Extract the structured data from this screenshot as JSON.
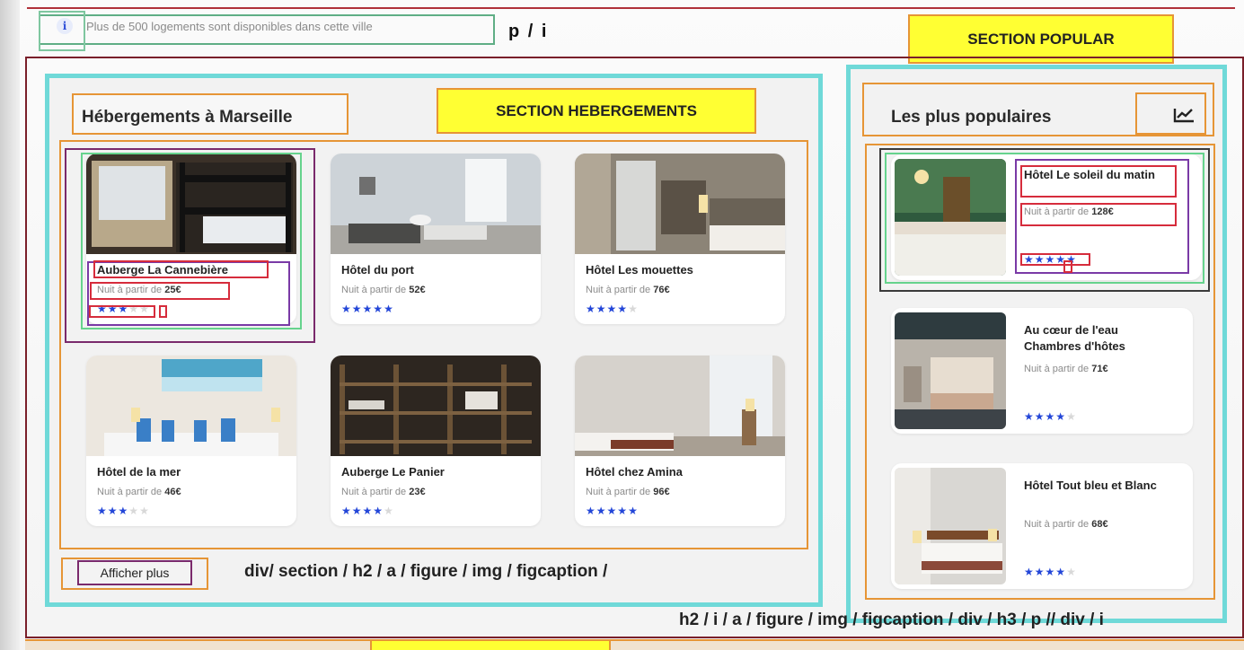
{
  "info": {
    "icon": "info-icon",
    "glyph": "i",
    "text": "Plus de 500 logements sont disponibles dans cette ville",
    "tag": "p / i"
  },
  "labels": {
    "popular": "SECTION POPULAR",
    "hebergements": "SECTION HEBERGEMENTS"
  },
  "hebergements": {
    "title": "Hébergements à Marseille",
    "price_prefix": "Nuit à partir de",
    "cards": [
      {
        "name": "Auberge La Cannebière",
        "price": "25€",
        "rating": 3,
        "max": 5
      },
      {
        "name": "Hôtel du port",
        "price": "52€",
        "rating": 5,
        "max": 5
      },
      {
        "name": "Hôtel Les mouettes",
        "price": "76€",
        "rating": 4,
        "max": 5
      },
      {
        "name": "Hôtel de la mer",
        "price": "46€",
        "rating": 3,
        "max": 5
      },
      {
        "name": "Auberge Le Panier",
        "price": "23€",
        "rating": 4,
        "max": 5
      },
      {
        "name": "Hôtel chez Amina",
        "price": "96€",
        "rating": 5,
        "max": 5
      }
    ],
    "show_more": "Afficher plus",
    "tags": "div/ section / h2 / a / figure / img / figcaption /"
  },
  "popular": {
    "title": "Les plus populaires",
    "chart_icon": "trending-chart-icon",
    "price_prefix": "Nuit à partir de",
    "cards": [
      {
        "name": "Hôtel Le soleil du matin",
        "price": "128€",
        "rating": 5,
        "max": 5
      },
      {
        "name": "Au cœur de l'eau Chambres d'hôtes",
        "price": "71€",
        "rating": 4,
        "max": 5
      },
      {
        "name": "Hôtel Tout bleu et Blanc",
        "price": "68€",
        "rating": 4,
        "max": 5
      }
    ],
    "tags": "h2 / i / a / figure / img / figcaption / div / h3 / p // div / i"
  },
  "colors": {
    "star": "#2346d8",
    "star_empty": "#d8d8d8",
    "section_border": "#6fd9d8",
    "label_yellow": "#ffff33"
  }
}
